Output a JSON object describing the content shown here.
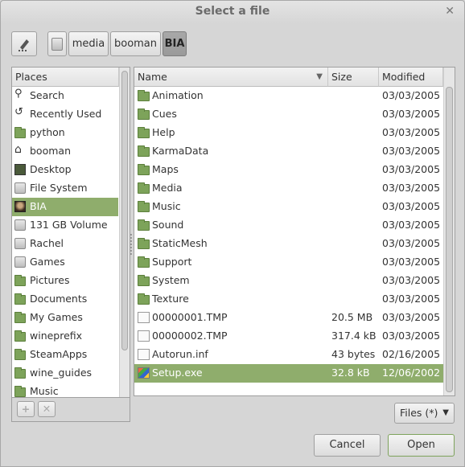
{
  "window": {
    "title": "Select a file"
  },
  "path": {
    "segments": [
      "media",
      "booman",
      "BIA"
    ],
    "active_index": 2
  },
  "places": {
    "header": "Places",
    "items": [
      {
        "label": "Search",
        "icon": "search-icon"
      },
      {
        "label": "Recently Used",
        "icon": "recent-icon"
      },
      {
        "label": "python",
        "icon": "folder-icon"
      },
      {
        "label": "booman",
        "icon": "home-icon"
      },
      {
        "label": "Desktop",
        "icon": "desktop-icon"
      },
      {
        "label": "File System",
        "icon": "drive-icon"
      },
      {
        "label": "BIA",
        "icon": "avatar-icon",
        "selected": true
      },
      {
        "label": "131 GB Volume",
        "icon": "drive-icon"
      },
      {
        "label": "Rachel",
        "icon": "drive-icon"
      },
      {
        "label": "Games",
        "icon": "drive-icon"
      },
      {
        "label": "Pictures",
        "icon": "pictures-folder-icon"
      },
      {
        "label": "Documents",
        "icon": "documents-folder-icon"
      },
      {
        "label": "My Games",
        "icon": "folder-icon"
      },
      {
        "label": "wineprefix",
        "icon": "folder-icon"
      },
      {
        "label": "SteamApps",
        "icon": "folder-icon"
      },
      {
        "label": "wine_guides",
        "icon": "folder-icon"
      },
      {
        "label": "Music",
        "icon": "folder-icon"
      }
    ]
  },
  "files": {
    "columns": {
      "name": "Name",
      "size": "Size",
      "modified": "Modified"
    },
    "rows": [
      {
        "name": "Animation",
        "size": "",
        "modified": "03/03/2005",
        "type": "folder"
      },
      {
        "name": "Cues",
        "size": "",
        "modified": "03/03/2005",
        "type": "folder"
      },
      {
        "name": "Help",
        "size": "",
        "modified": "03/03/2005",
        "type": "folder"
      },
      {
        "name": "KarmaData",
        "size": "",
        "modified": "03/03/2005",
        "type": "folder"
      },
      {
        "name": "Maps",
        "size": "",
        "modified": "03/03/2005",
        "type": "folder"
      },
      {
        "name": "Media",
        "size": "",
        "modified": "03/03/2005",
        "type": "folder"
      },
      {
        "name": "Music",
        "size": "",
        "modified": "03/03/2005",
        "type": "folder"
      },
      {
        "name": "Sound",
        "size": "",
        "modified": "03/03/2005",
        "type": "folder"
      },
      {
        "name": "StaticMesh",
        "size": "",
        "modified": "03/03/2005",
        "type": "folder"
      },
      {
        "name": "Support",
        "size": "",
        "modified": "03/03/2005",
        "type": "folder"
      },
      {
        "name": "System",
        "size": "",
        "modified": "03/03/2005",
        "type": "folder"
      },
      {
        "name": "Texture",
        "size": "",
        "modified": "03/03/2005",
        "type": "folder"
      },
      {
        "name": "00000001.TMP",
        "size": "20.5 MB",
        "modified": "03/03/2005",
        "type": "binary"
      },
      {
        "name": "00000002.TMP",
        "size": "317.4 kB",
        "modified": "03/03/2005",
        "type": "binary"
      },
      {
        "name": "Autorun.inf",
        "size": "43 bytes",
        "modified": "02/16/2005",
        "type": "text"
      },
      {
        "name": "Setup.exe",
        "size": "32.8 kB",
        "modified": "12/06/2002",
        "type": "exe",
        "selected": true
      }
    ]
  },
  "filter": {
    "label": "Files (*)"
  },
  "buttons": {
    "cancel": "Cancel",
    "open": "Open"
  },
  "colors": {
    "selection": "#8fad6c",
    "folder": "#7da35a"
  }
}
